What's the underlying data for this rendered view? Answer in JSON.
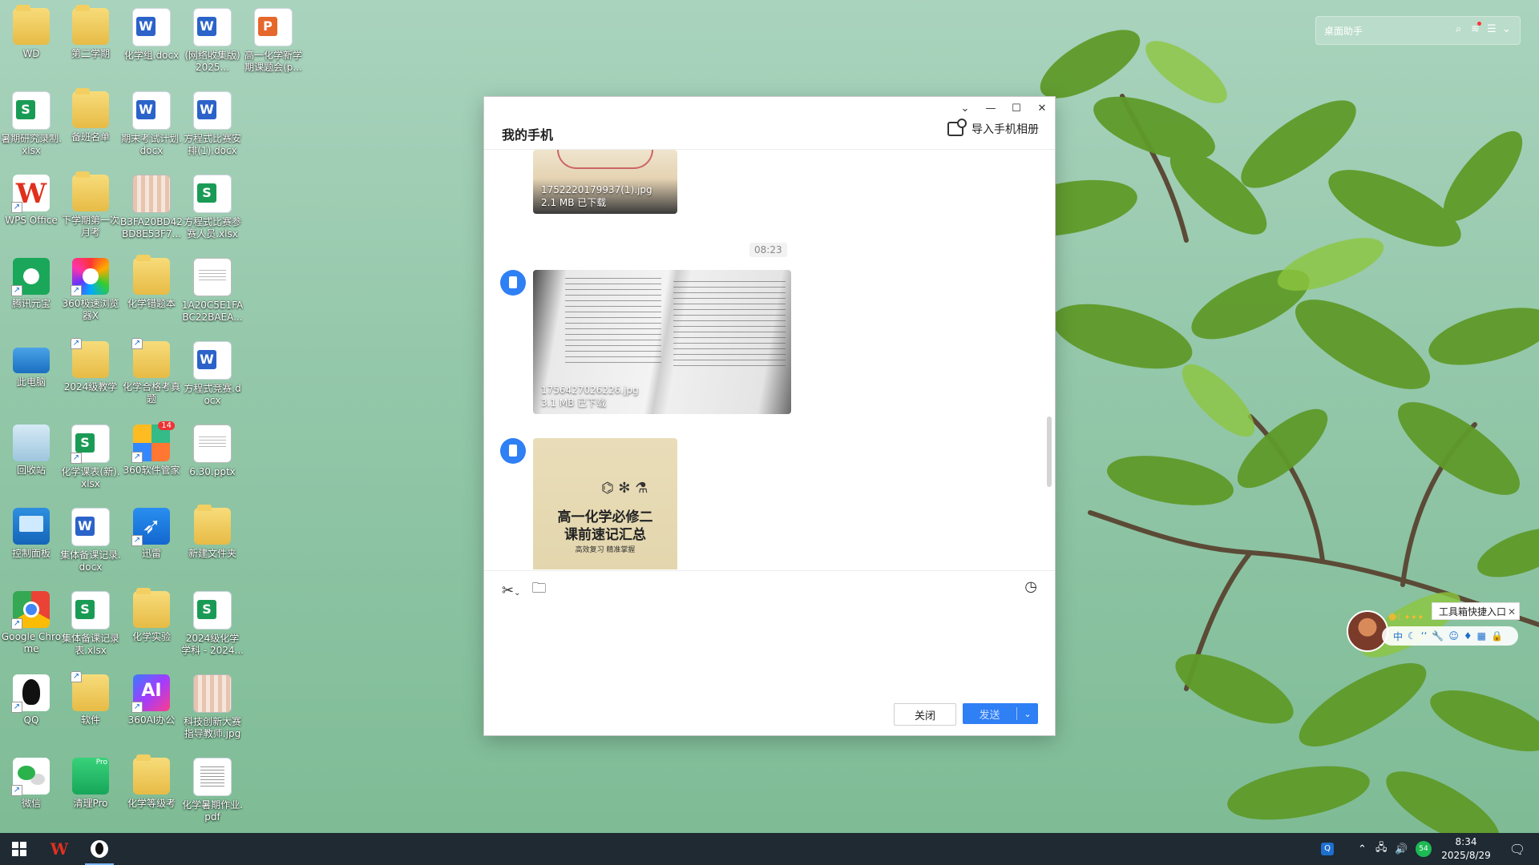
{
  "desktop": {
    "icons": [
      {
        "label": "WD"
      },
      {
        "label": "第二学期"
      },
      {
        "label": "化学组.docx"
      },
      {
        "label": "(网络收集版) 2025..."
      },
      {
        "label": "高一化学新学期课题会(p..."
      },
      {
        "label": "暑期研究录制.xlsx"
      },
      {
        "label": "备班名单"
      },
      {
        "label": "期末考试计划.docx"
      },
      {
        "label": "方程式比赛安排(1).docx"
      },
      {
        "label": "WPS Office"
      },
      {
        "label": "下学期第一次月考"
      },
      {
        "label": "B3FA20BD42BD8E53F7..."
      },
      {
        "label": "方程式比赛参赛人员.xlsx"
      },
      {
        "label": "腾讯元宝"
      },
      {
        "label": "360极速浏览器X"
      },
      {
        "label": "化学错题本"
      },
      {
        "label": "1A20C5E1FABC22BAEA..."
      },
      {
        "label": "此电脑"
      },
      {
        "label": "2024级教学"
      },
      {
        "label": "化学合格考真题"
      },
      {
        "label": "方程式竞赛.docx"
      },
      {
        "label": "回收站"
      },
      {
        "label": "化学课表(新).xlsx"
      },
      {
        "label": "360软件管家",
        "badge": "14"
      },
      {
        "label": "6.30.pptx"
      },
      {
        "label": "控制面板"
      },
      {
        "label": "集体备课记录.docx"
      },
      {
        "label": "迅雷"
      },
      {
        "label": "新建文件夹"
      },
      {
        "label": "Google Chrome"
      },
      {
        "label": "集体备课记录表.xlsx"
      },
      {
        "label": "化学实验"
      },
      {
        "label": "2024级化学学科 - 2024..."
      },
      {
        "label": "QQ"
      },
      {
        "label": "软件"
      },
      {
        "label": "360AI办公"
      },
      {
        "label": "科技创新大赛指导教师.jpg"
      },
      {
        "label": "微信"
      },
      {
        "label": "清理Pro"
      },
      {
        "label": "化学等级考"
      },
      {
        "label": "化学暑期作业.pdf"
      }
    ]
  },
  "widget": {
    "title": "桌面助手"
  },
  "window": {
    "title": "我的手机",
    "import_label": "导入手机相册",
    "controls": {
      "dropdown": "⌄",
      "minimize": "—",
      "maximize": "☐",
      "close": "✕"
    },
    "messages": [
      {
        "filename": "1752220179937(1).jpg",
        "status": "2.1 MB 已下载"
      },
      {
        "filename": "1756427026226.jpg",
        "status": "3.1 MB 已下载"
      },
      {
        "image_text_line1": "高一化学必修二",
        "image_text_line2": "课前速记汇总",
        "image_text_sub": "高效复习  精准掌握"
      }
    ],
    "timestamp": "08:23",
    "close_button": "关闭",
    "send_button": "发送"
  },
  "floatbar": {
    "tooltip": "工具箱快捷入口",
    "pill_first": "中"
  },
  "taskbar": {
    "time": "8:34",
    "date": "2025/8/29",
    "speed": "54"
  }
}
